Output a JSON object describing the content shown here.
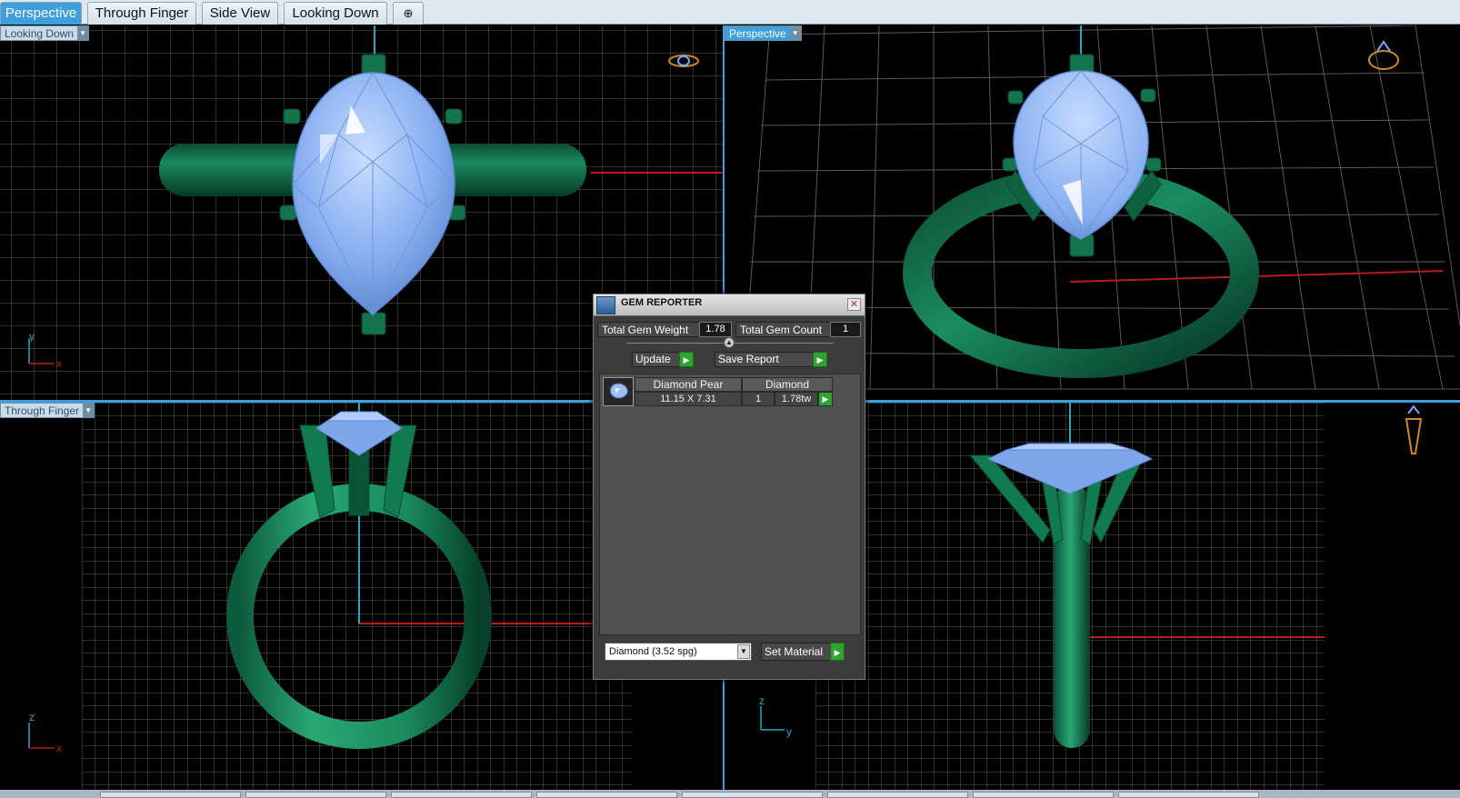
{
  "tabs": [
    {
      "label": "Perspective",
      "active": true
    },
    {
      "label": "Through Finger",
      "active": false
    },
    {
      "label": "Side View",
      "active": false
    },
    {
      "label": "Looking Down",
      "active": false
    }
  ],
  "tab_add_glyph": "⊕",
  "viewports": {
    "top_left": {
      "label": "Looking Down",
      "axes": [
        "y",
        "x"
      ]
    },
    "top_right": {
      "label": "Perspective"
    },
    "bottom_left": {
      "label": "Through Finger",
      "axes": [
        "z",
        "x"
      ]
    },
    "bottom_right": {
      "label": "",
      "axes": [
        "z",
        "y"
      ]
    }
  },
  "gem_reporter": {
    "title": "GEM REPORTER",
    "total_weight_label": "Total Gem Weight",
    "total_weight_value": "1.78",
    "total_count_label": "Total Gem Count",
    "total_count_value": "1",
    "update_label": "Update",
    "save_report_label": "Save Report",
    "gem_rows": [
      {
        "name": "Diamond Pear",
        "material": "Diamond",
        "size": "11.15 X 7.31",
        "qty": "1",
        "weight": "1.78tw"
      }
    ],
    "material_select_value": "Diamond    (3.52 spg)",
    "set_material_label": "Set Material"
  },
  "colors": {
    "tab_active": "#3da0dc",
    "metal": "#0f6b47",
    "gem": "#8db8f5",
    "grid": "#6d6d6d",
    "axis_red": "#b81c1c",
    "axis_cyan": "#2aa6c7"
  }
}
